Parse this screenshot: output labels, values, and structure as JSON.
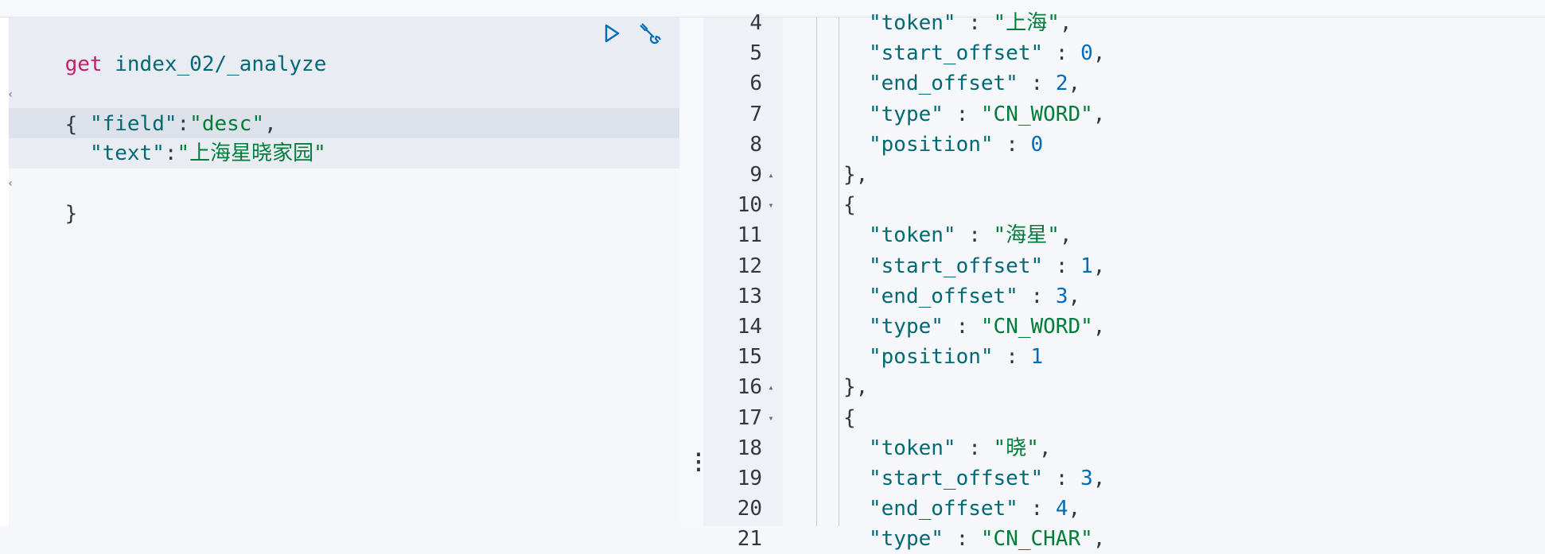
{
  "colors": {
    "method": "#c61e6a",
    "path": "#016974",
    "key": "#016974",
    "string": "#017d3a",
    "number": "#006bb8",
    "punct": "#343741"
  },
  "request": {
    "method": "get",
    "path": "index_02/_analyze",
    "open_brace": "{",
    "field_key": "\"field\"",
    "field_colon": ":",
    "field_value": "\"desc\"",
    "field_comma": ",",
    "text_key": "\"text\"",
    "text_colon": ":",
    "text_value": "\"上海星晓家园\"",
    "close_brace": "}"
  },
  "actions": {
    "run_icon": "play-triangle-icon",
    "settings_icon": "wrench-icon"
  },
  "splitter": {
    "icon": "vertical-dots-icon",
    "glyph": "⋮"
  },
  "response": {
    "line_numbers": [
      "4",
      "5",
      "6",
      "7",
      "8",
      "9",
      "10",
      "11",
      "12",
      "13",
      "14",
      "15",
      "16",
      "17",
      "18",
      "19",
      "20",
      "21"
    ],
    "lines": [
      {
        "k": "\"token\"",
        "sep": " : ",
        "v": "\"上海\"",
        "vt": "str",
        "end": ","
      },
      {
        "k": "\"start_offset\"",
        "sep": " : ",
        "v": "0",
        "vt": "num",
        "end": ","
      },
      {
        "k": "\"end_offset\"",
        "sep": " : ",
        "v": "2",
        "vt": "num",
        "end": ","
      },
      {
        "k": "\"type\"",
        "sep": " : ",
        "v": "\"CN_WORD\"",
        "vt": "str",
        "end": ","
      },
      {
        "k": "\"position\"",
        "sep": " : ",
        "v": "0",
        "vt": "num",
        "end": ""
      },
      {
        "p": "},"
      },
      {
        "p": "{"
      },
      {
        "k": "\"token\"",
        "sep": " : ",
        "v": "\"海星\"",
        "vt": "str",
        "end": ","
      },
      {
        "k": "\"start_offset\"",
        "sep": " : ",
        "v": "1",
        "vt": "num",
        "end": ","
      },
      {
        "k": "\"end_offset\"",
        "sep": " : ",
        "v": "3",
        "vt": "num",
        "end": ","
      },
      {
        "k": "\"type\"",
        "sep": " : ",
        "v": "\"CN_WORD\"",
        "vt": "str",
        "end": ","
      },
      {
        "k": "\"position\"",
        "sep": " : ",
        "v": "1",
        "vt": "num",
        "end": ""
      },
      {
        "p": "},"
      },
      {
        "p": "{"
      },
      {
        "k": "\"token\"",
        "sep": " : ",
        "v": "\"晓\"",
        "vt": "str",
        "end": ","
      },
      {
        "k": "\"start_offset\"",
        "sep": " : ",
        "v": "3",
        "vt": "num",
        "end": ","
      },
      {
        "k": "\"end_offset\"",
        "sep": " : ",
        "v": "4",
        "vt": "num",
        "end": ","
      },
      {
        "k": "\"type\"",
        "sep": " : ",
        "v": "\"CN_CHAR\"",
        "vt": "str",
        "end": ","
      }
    ],
    "fold_glyphs": {
      "9": "▴",
      "10": "▾",
      "16": "▴",
      "17": "▾"
    }
  }
}
